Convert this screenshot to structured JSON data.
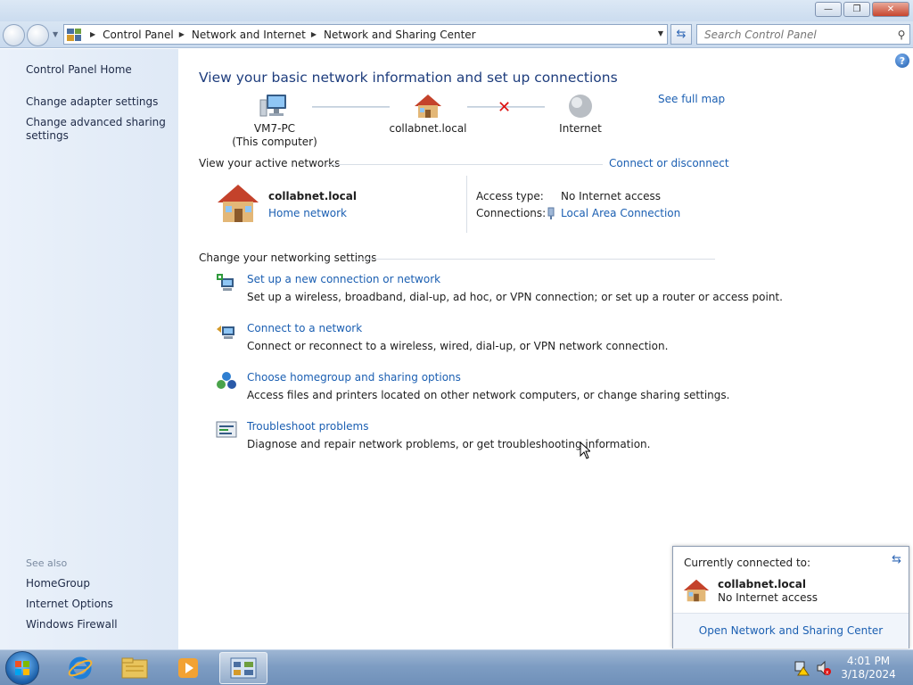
{
  "window": {
    "minimize_glyph": "—",
    "restore_glyph": "❐",
    "close_glyph": "✕"
  },
  "address": {
    "crumbs": [
      "Control Panel",
      "Network and Internet",
      "Network and Sharing Center"
    ],
    "search_placeholder": "Search Control Panel"
  },
  "sidebar": {
    "items": [
      {
        "label": "Control Panel Home"
      },
      {
        "label": "Change adapter settings"
      },
      {
        "label": "Change advanced sharing settings"
      }
    ],
    "see_also_heading": "See also",
    "see_also": [
      {
        "label": "HomeGroup"
      },
      {
        "label": "Internet Options"
      },
      {
        "label": "Windows Firewall"
      }
    ]
  },
  "main": {
    "title": "View your basic network information and set up connections",
    "see_full_map": "See full map",
    "map": {
      "computer_name": "VM7-PC",
      "computer_sub": "(This computer)",
      "network_name": "collabnet.local",
      "internet_label": "Internet"
    },
    "active_heading": "View your active networks",
    "connect_link": "Connect or disconnect",
    "active": {
      "name": "collabnet.local",
      "category": "Home network",
      "access_type_label": "Access type:",
      "access_type_value": "No Internet access",
      "connections_label": "Connections:",
      "connections_value": "Local Area Connection"
    },
    "settings_heading": "Change your networking settings",
    "tasks": [
      {
        "title": "Set up a new connection or network",
        "desc": "Set up a wireless, broadband, dial-up, ad hoc, or VPN connection; or set up a router or access point."
      },
      {
        "title": "Connect to a network",
        "desc": "Connect or reconnect to a wireless, wired, dial-up, or VPN network connection."
      },
      {
        "title": "Choose homegroup and sharing options",
        "desc": "Access files and printers located on other network computers, or change sharing settings."
      },
      {
        "title": "Troubleshoot problems",
        "desc": "Diagnose and repair network problems, or get troubleshooting information."
      }
    ]
  },
  "popup": {
    "heading": "Currently connected to:",
    "network_name": "collabnet.local",
    "status": "No Internet access",
    "open_link": "Open Network and Sharing Center"
  },
  "taskbar": {
    "time": "4:01 PM",
    "date": "3/18/2024"
  },
  "colors": {
    "link": "#1b5fb2",
    "title": "#1e3d7d",
    "error_x": "#dd1111"
  }
}
